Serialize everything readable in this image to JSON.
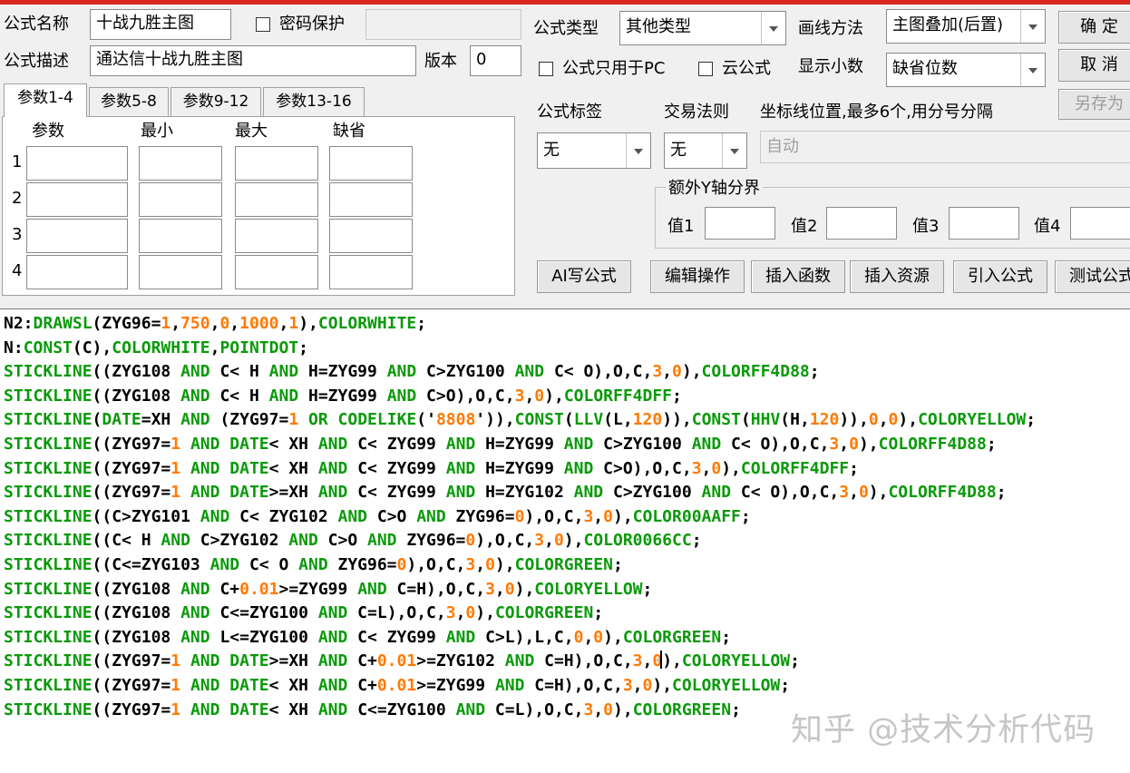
{
  "colors": {
    "keyword": "#0a9a0a",
    "number": "#ff7a00",
    "text": "#000000",
    "accent_bar": "#d8261c"
  },
  "form": {
    "name_label": "公式名称",
    "name_value": "十战九胜主图",
    "password_label": "密码保护",
    "desc_label": "公式描述",
    "desc_value": "通达信十战九胜主图",
    "version_label": "版本",
    "version_value": "0",
    "type_label": "公式类型",
    "type_value": "其他类型",
    "draw_label": "画线方法",
    "draw_value": "主图叠加(后置)",
    "pc_only_label": "公式只用于PC",
    "cloud_label": "云公式",
    "decimals_label": "显示小数",
    "decimals_value": "缺省位数",
    "tag_label": "公式标签",
    "tag_value": "无",
    "trade_label": "交易法则",
    "trade_value": "无",
    "axis_label": "坐标线位置,最多6个,用分号分隔",
    "axis_value": "自动",
    "extra_y_label": "额外Y轴分界",
    "v1_label": "值1",
    "v2_label": "值2",
    "v3_label": "值3",
    "v4_label": "值4"
  },
  "buttons": {
    "ok": "确 定",
    "cancel": "取 消",
    "save_as": "另存为",
    "ai": "AI写公式",
    "edit": "编辑操作",
    "insert_func": "插入函数",
    "insert_res": "插入资源",
    "import": "引入公式",
    "test": "测试公式"
  },
  "tabs": [
    "参数1-4",
    "参数5-8",
    "参数9-12",
    "参数13-16"
  ],
  "params": {
    "headers": [
      "参数",
      "最小",
      "最大",
      "缺省"
    ],
    "rows": [
      "1",
      "2",
      "3",
      "4"
    ]
  },
  "code_lines": [
    "N2:DRAWSL(ZYG96=1,750,0,1000,1),COLORWHITE;",
    "N:CONST(C),COLORWHITE,POINTDOT;",
    "STICKLINE((ZYG108 AND C< H AND H=ZYG99 AND C>ZYG100 AND C< O),O,C,3,0),COLORFF4D88;",
    "STICKLINE((ZYG108 AND C< H AND H=ZYG99 AND C>O),O,C,3,0),COLORFF4DFF;",
    "STICKLINE(DATE=XH AND (ZYG97=1 OR CODELIKE('8808')),CONST(LLV(L,120)),CONST(HHV(H,120)),0,0),COLORYELLOW;",
    "STICKLINE((ZYG97=1 AND DATE< XH AND C< ZYG99 AND H=ZYG99 AND C>ZYG100 AND C< O),O,C,3,0),COLORFF4D88;",
    "STICKLINE((ZYG97=1 AND DATE< XH AND C< ZYG99 AND H=ZYG99 AND C>O),O,C,3,0),COLORFF4DFF;",
    "STICKLINE((ZYG97=1 AND DATE>=XH AND C< ZYG99 AND H=ZYG102 AND C>ZYG100 AND C< O),O,C,3,0),COLORFF4D88;",
    "STICKLINE((C>ZYG101 AND C< ZYG102 AND C>O AND ZYG96=0),O,C,3,0),COLOR00AAFF;",
    "STICKLINE((C< H AND C>ZYG102 AND C>O AND ZYG96=0),O,C,3,0),COLOR0066CC;",
    "STICKLINE((C<=ZYG103 AND C< O AND ZYG96=0),O,C,3,0),COLORGREEN;",
    "STICKLINE((ZYG108 AND C+0.01>=ZYG99 AND C=H),O,C,3,0),COLORYELLOW;",
    "STICKLINE((ZYG108 AND C<=ZYG100 AND C=L),O,C,3,0),COLORGREEN;",
    "STICKLINE((ZYG108 AND L<=ZYG100 AND C< ZYG99 AND C>L),L,C,0,0),COLORGREEN;",
    "STICKLINE((ZYG97=1 AND DATE>=XH AND C+0.01>=ZYG102 AND C=H),O,C,3,0),COLORYELLOW;",
    "STICKLINE((ZYG97=1 AND DATE< XH AND C+0.01>=ZYG99 AND C=H),O,C,3,0),COLORYELLOW;",
    "STICKLINE((ZYG97=1 AND DATE< XH AND C<=ZYG100 AND C=L),O,C,3,0),COLORGREEN;"
  ],
  "watermark": "知乎 @技术分析代码"
}
